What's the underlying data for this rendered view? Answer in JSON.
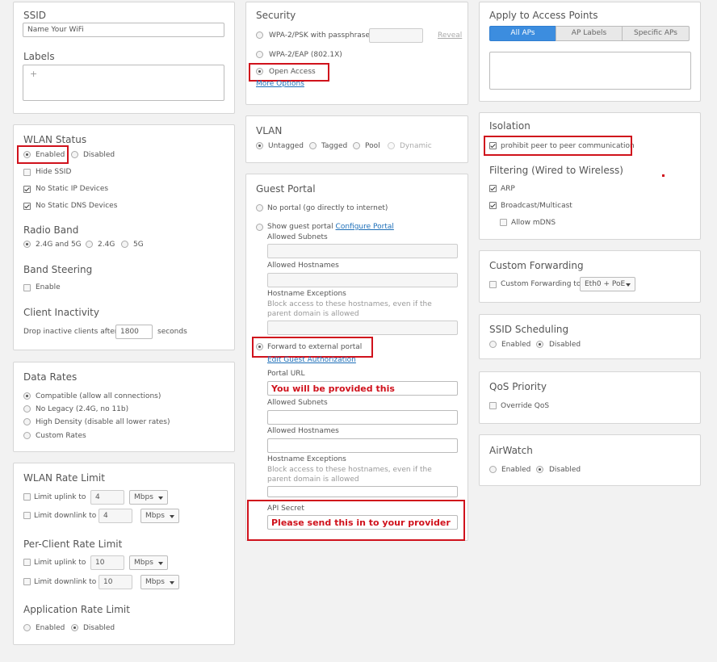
{
  "ssid": {
    "heading": "SSID",
    "value": "Name Your WiFi",
    "labels_heading": "Labels",
    "add_symbol": "+"
  },
  "wlan_status": {
    "heading": "WLAN Status",
    "enabled": "Enabled",
    "disabled": "Disabled",
    "hide_ssid": "Hide SSID",
    "no_static_ip": "No Static IP Devices",
    "no_static_dns": "No Static DNS Devices",
    "radio_band_heading": "Radio Band",
    "band_both": "2.4G and 5G",
    "band_24": "2.4G",
    "band_5": "5G",
    "band_steering_heading": "Band Steering",
    "band_steering_enable": "Enable",
    "client_inactivity_heading": "Client Inactivity",
    "drop_label": "Drop inactive clients after",
    "drop_value": "1800",
    "drop_unit": "seconds"
  },
  "data_rates": {
    "heading": "Data Rates",
    "options": [
      "Compatible (allow all connections)",
      "No Legacy (2.4G, no 11b)",
      "High Density (disable all lower rates)",
      "Custom Rates"
    ]
  },
  "rate_limit": {
    "heading": "WLAN Rate Limit",
    "uplink": "Limit uplink to",
    "downlink": "Limit downlink to",
    "wlan_up_value": "4",
    "wlan_down_value": "4",
    "unit": "Mbps",
    "per_client_heading": "Per-Client Rate Limit",
    "pc_up_value": "10",
    "pc_down_value": "10",
    "app_heading": "Application Rate Limit",
    "enabled": "Enabled",
    "disabled": "Disabled"
  },
  "security": {
    "heading": "Security",
    "wpa_psk": "WPA-2/PSK with passphrase",
    "reveal": "Reveal",
    "wpa_eap": "WPA-2/EAP (802.1X)",
    "open_access": "Open Access",
    "more_options": "More Options"
  },
  "vlan": {
    "heading": "VLAN",
    "untagged": "Untagged",
    "tagged": "Tagged",
    "pool": "Pool",
    "dynamic": "Dynamic"
  },
  "guest_portal": {
    "heading": "Guest Portal",
    "no_portal": "No portal (go directly to internet)",
    "show_portal": "Show guest portal",
    "configure_portal": "Configure Portal",
    "allowed_subnets": "Allowed Subnets",
    "allowed_hostnames": "Allowed Hostnames",
    "hostname_exceptions": "Hostname Exceptions",
    "hostname_exceptions_help": "Block access to these hostnames, even if the parent domain is allowed",
    "forward_external": "Forward to external portal",
    "edit_guest_auth": "Edit Guest Authorization",
    "portal_url_label": "Portal URL",
    "portal_url_value": "You will be provided this",
    "api_secret_label": "API Secret",
    "api_secret_value": "Please send this in to your provider"
  },
  "apply_to_aps": {
    "heading": "Apply to Access Points",
    "tabs": [
      "All APs",
      "AP Labels",
      "Specific APs"
    ]
  },
  "isolation": {
    "heading": "Isolation",
    "prohibit_p2p": "prohibit peer to peer communication",
    "filtering_heading": "Filtering (Wired to Wireless)",
    "arp": "ARP",
    "broadcast": "Broadcast/Multicast",
    "allow_mdns": "Allow mDNS"
  },
  "custom_forwarding": {
    "heading": "Custom Forwarding",
    "label": "Custom Forwarding to",
    "select_value": "Eth0 + PoE"
  },
  "ssid_scheduling": {
    "heading": "SSID Scheduling",
    "enabled": "Enabled",
    "disabled": "Disabled"
  },
  "qos": {
    "heading": "QoS Priority",
    "override": "Override QoS"
  },
  "airwatch": {
    "heading": "AirWatch",
    "enabled": "Enabled",
    "disabled": "Disabled"
  }
}
